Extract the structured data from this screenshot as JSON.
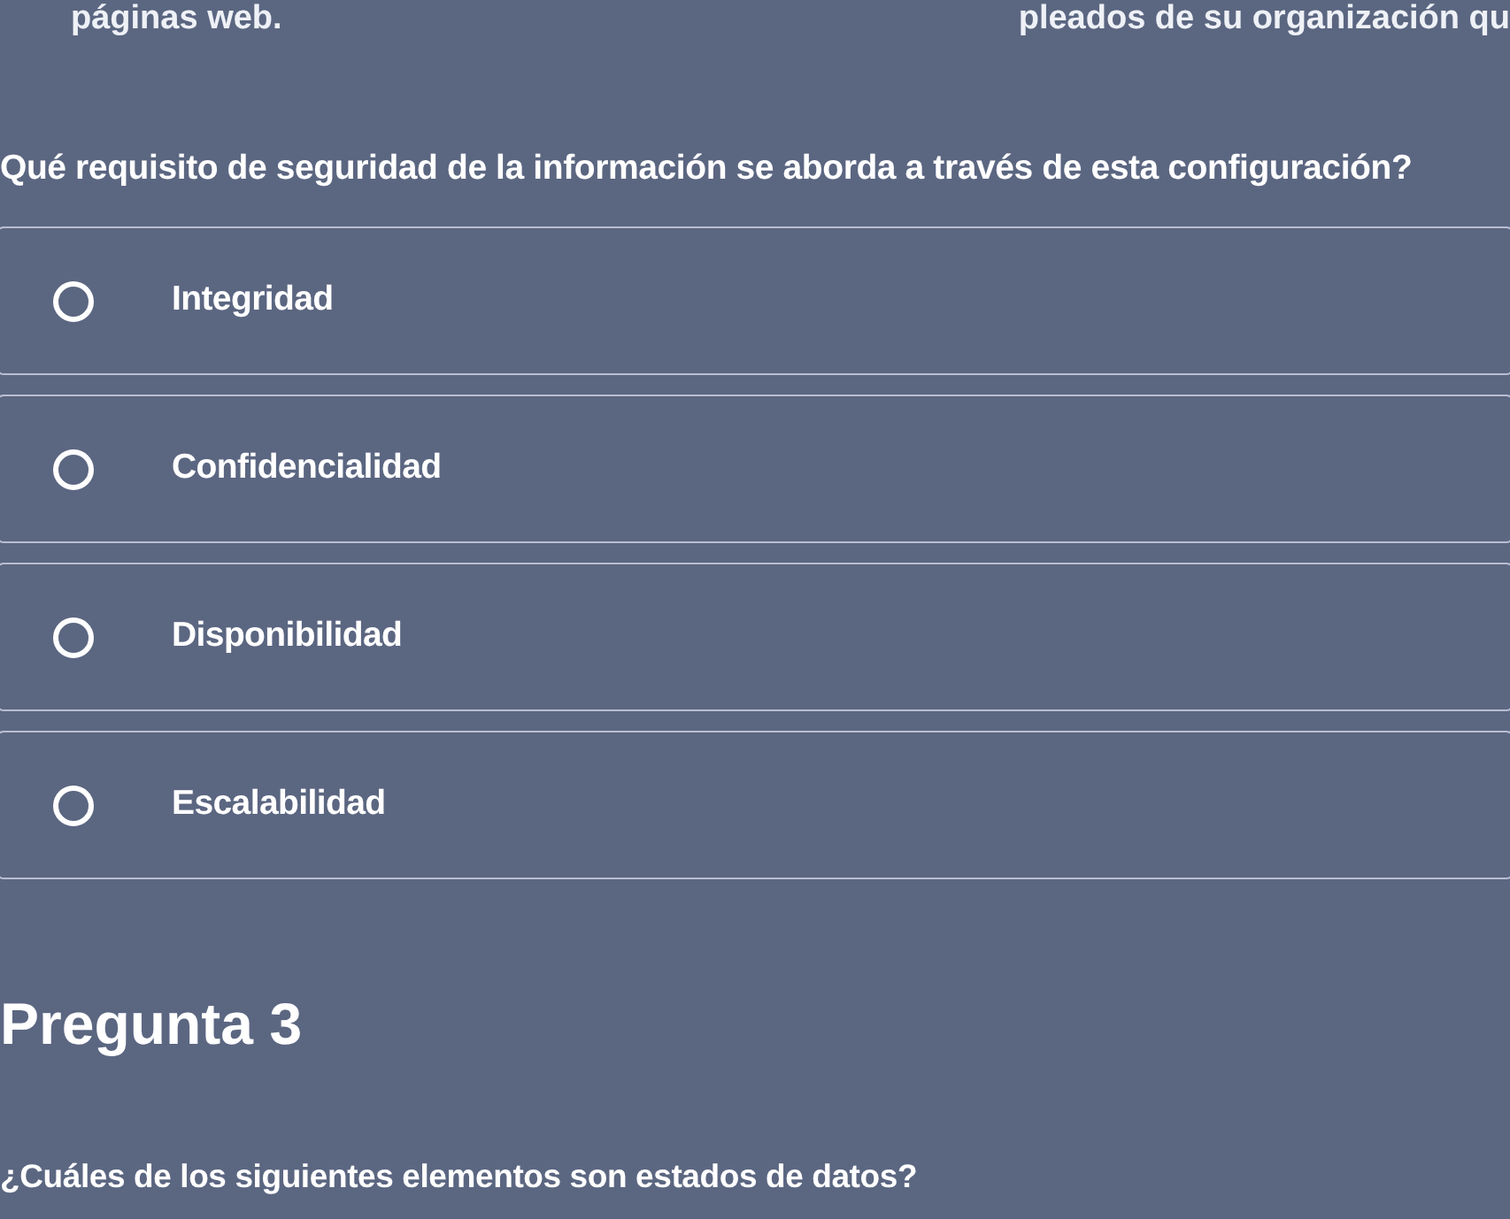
{
  "top_fragments": {
    "left": "páginas web.",
    "right": "pleados de su organización qu"
  },
  "question": {
    "text": "Qué requisito de seguridad de la información se aborda a través de esta configuración?"
  },
  "options": [
    {
      "label": "Integridad",
      "selected": false
    },
    {
      "label": "Confidencialidad",
      "selected": false
    },
    {
      "label": "Disponibilidad",
      "selected": false
    },
    {
      "label": "Escalabilidad",
      "selected": false
    }
  ],
  "next_question": {
    "title": "Pregunta 3",
    "text": "¿Cuáles de los siguientes elementos son estados de datos?"
  }
}
